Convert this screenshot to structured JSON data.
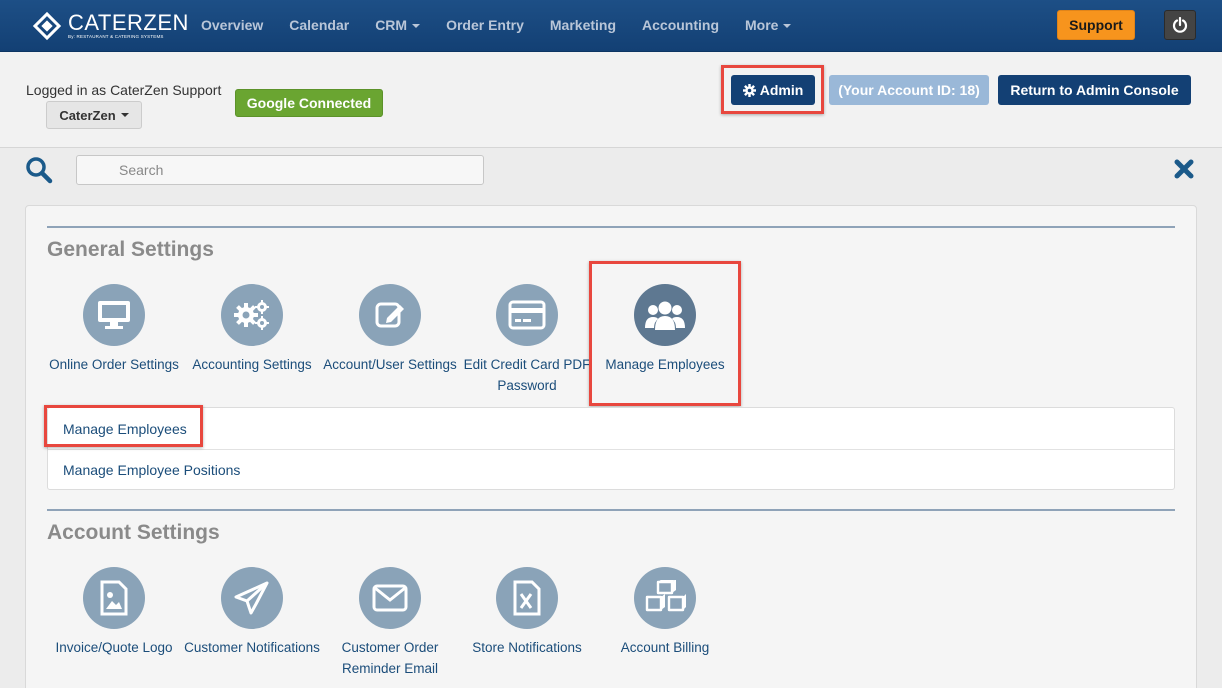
{
  "navbar": {
    "logo_name": "CATERZEN",
    "logo_sub": "By: RESTAURANT & CATERING SYSTEMS",
    "links": [
      {
        "label": "Overview"
      },
      {
        "label": "Calendar"
      },
      {
        "label": "CRM",
        "dropdown": true
      },
      {
        "label": "Order Entry"
      },
      {
        "label": "Marketing"
      },
      {
        "label": "Accounting"
      },
      {
        "label": "More",
        "dropdown": true
      }
    ],
    "support_label": "Support",
    "power_icon": "power-icon"
  },
  "header": {
    "logged_in_text": "Logged in as CaterZen Support",
    "account_dropdown": "CaterZen",
    "google_label": "Google Connected",
    "admin_label": "Admin",
    "account_id_label": "(Your Account ID: 18)",
    "return_label": "Return to Admin Console"
  },
  "search": {
    "placeholder": "Search"
  },
  "general_settings": {
    "title": "General Settings",
    "tiles": [
      {
        "label": "Online Order Settings",
        "icon": "monitor-icon"
      },
      {
        "label": "Accounting Settings",
        "icon": "gears-icon"
      },
      {
        "label": "Account/User Settings",
        "icon": "edit-icon"
      },
      {
        "label": "Edit Credit Card PDF Password",
        "icon": "credit-card-icon"
      },
      {
        "label": "Manage Employees",
        "icon": "users-icon",
        "active": true
      }
    ],
    "sub_items": [
      {
        "label": "Manage Employees"
      },
      {
        "label": "Manage Employee Positions"
      }
    ]
  },
  "account_settings": {
    "title": "Account Settings",
    "tiles": [
      {
        "label": "Invoice/Quote Logo",
        "icon": "image-file-icon"
      },
      {
        "label": "Customer Notifications",
        "icon": "paper-plane-icon"
      },
      {
        "label": "Customer Order Reminder Email",
        "icon": "envelope-icon"
      },
      {
        "label": "Store Notifications",
        "icon": "excel-file-icon"
      },
      {
        "label": "Account Billing",
        "icon": "cubes-icon"
      }
    ]
  },
  "colors": {
    "navbar": "#134074",
    "accent_orange": "#f7941d",
    "google_green": "#6aa531",
    "highlight_red": "#e8473e",
    "link_blue": "#1b4d7a",
    "icon_circle": "#8aa3b8"
  }
}
